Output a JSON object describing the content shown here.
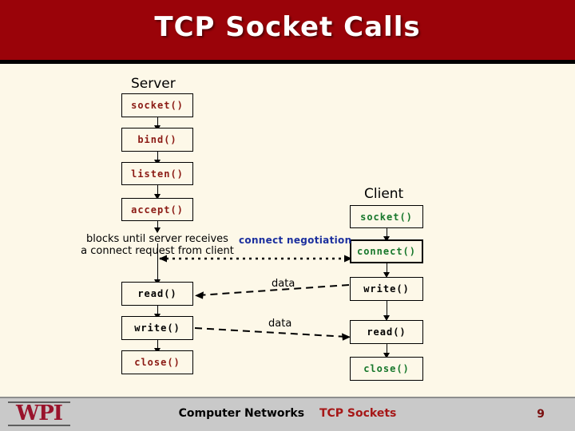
{
  "slide": {
    "title": "TCP Socket Calls",
    "banner_color": "#9A0309",
    "background_color": "#FDF8E8"
  },
  "server": {
    "heading": "Server",
    "calls": [
      {
        "label": "socket()",
        "color": "red"
      },
      {
        "label": "bind()",
        "color": "red"
      },
      {
        "label": "listen()",
        "color": "red"
      },
      {
        "label": "accept()",
        "color": "red"
      },
      {
        "label": "read()",
        "color": "black"
      },
      {
        "label": "write()",
        "color": "black"
      },
      {
        "label": "close()",
        "color": "red"
      }
    ],
    "note_line1": "blocks until server receives",
    "note_line2": "a connect request from client"
  },
  "client": {
    "heading": "Client",
    "calls": [
      {
        "label": "socket()",
        "color": "green"
      },
      {
        "label": "connect()",
        "color": "green"
      },
      {
        "label": "write()",
        "color": "black"
      },
      {
        "label": "read()",
        "color": "black"
      },
      {
        "label": "close()",
        "color": "green"
      }
    ]
  },
  "messages": [
    {
      "label": "connect negotiation",
      "color": "#1B2F9E",
      "style": "dotted",
      "direction": "both"
    },
    {
      "label": "data",
      "color": "#000000",
      "style": "dashed",
      "direction": "client-to-server"
    },
    {
      "label": "data",
      "color": "#000000",
      "style": "dashed",
      "direction": "server-to-client"
    }
  ],
  "footer": {
    "logo": "WPI",
    "course": "Computer Networks",
    "topic": "TCP Sockets",
    "page": "9"
  }
}
